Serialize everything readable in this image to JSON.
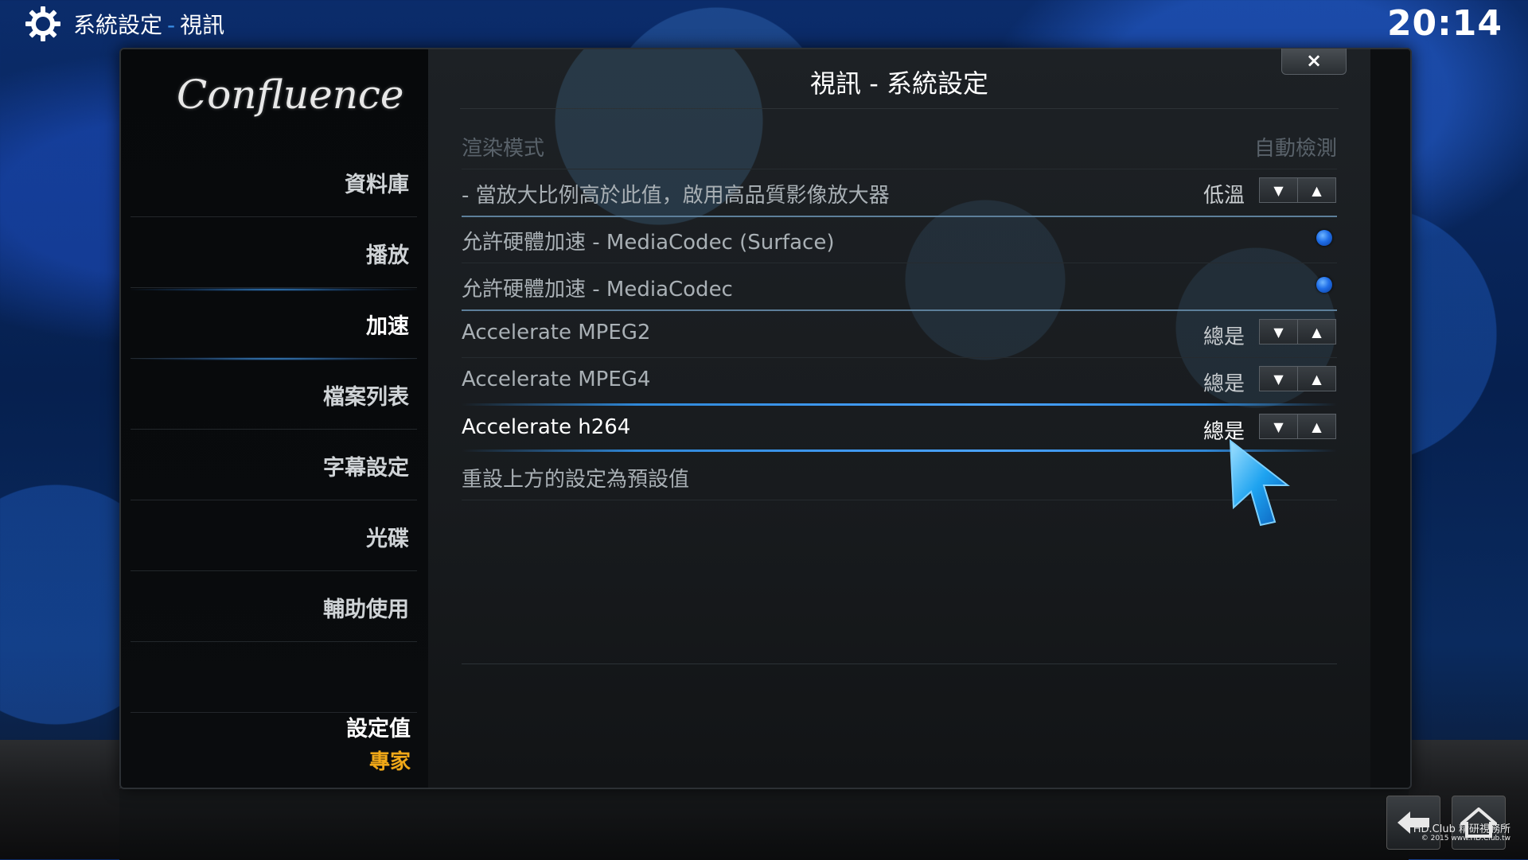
{
  "header": {
    "section": "系統設定",
    "separator": "-",
    "subsection": "視訊",
    "clock": "20:14"
  },
  "dialog": {
    "title": "視訊 - 系統設定",
    "close_label": "×",
    "logo_text": "Confluence"
  },
  "sidebar": {
    "items": [
      {
        "label": "資料庫",
        "active": false
      },
      {
        "label": "播放",
        "active": false
      },
      {
        "label": "加速",
        "active": true
      },
      {
        "label": "檔案列表",
        "active": false
      },
      {
        "label": "字幕設定",
        "active": false
      },
      {
        "label": "光碟",
        "active": false
      },
      {
        "label": "輔助使用",
        "active": false
      }
    ],
    "settings_level_label": "設定值",
    "settings_level_value": "專家"
  },
  "settings": {
    "rows": [
      {
        "label": "渲染模式",
        "value": "自動檢測",
        "type": "text",
        "disabled": true
      },
      {
        "label": "- 當放大比例高於此值，啟用高品質影像放大器",
        "value": "低溫",
        "type": "spinner"
      },
      {
        "label": "允許硬體加速 - MediaCodec (Surface)",
        "type": "radio",
        "checked": true
      },
      {
        "label": "允許硬體加速 - MediaCodec",
        "type": "radio",
        "checked": true
      },
      {
        "label": "Accelerate MPEG2",
        "value": "總是",
        "type": "spinner"
      },
      {
        "label": "Accelerate MPEG4",
        "value": "總是",
        "type": "spinner"
      },
      {
        "label": "Accelerate h264",
        "value": "總是",
        "type": "spinner",
        "focused": true
      },
      {
        "label": "重設上方的設定為預設值",
        "type": "action"
      }
    ]
  },
  "watermark": {
    "line1": "HD.Club 精研視務所",
    "line2": "© 2015  www.HD.Club.tw"
  },
  "colors": {
    "accent_blue": "#3a8ee6",
    "level_orange": "#f0a818",
    "radio_blue": "#1f6ee8"
  },
  "icons": {
    "header": "gear-icon",
    "back": "back-arrow-icon",
    "home": "home-icon",
    "spinner_down": "triangle-down-icon",
    "spinner_up": "triangle-up-icon"
  }
}
